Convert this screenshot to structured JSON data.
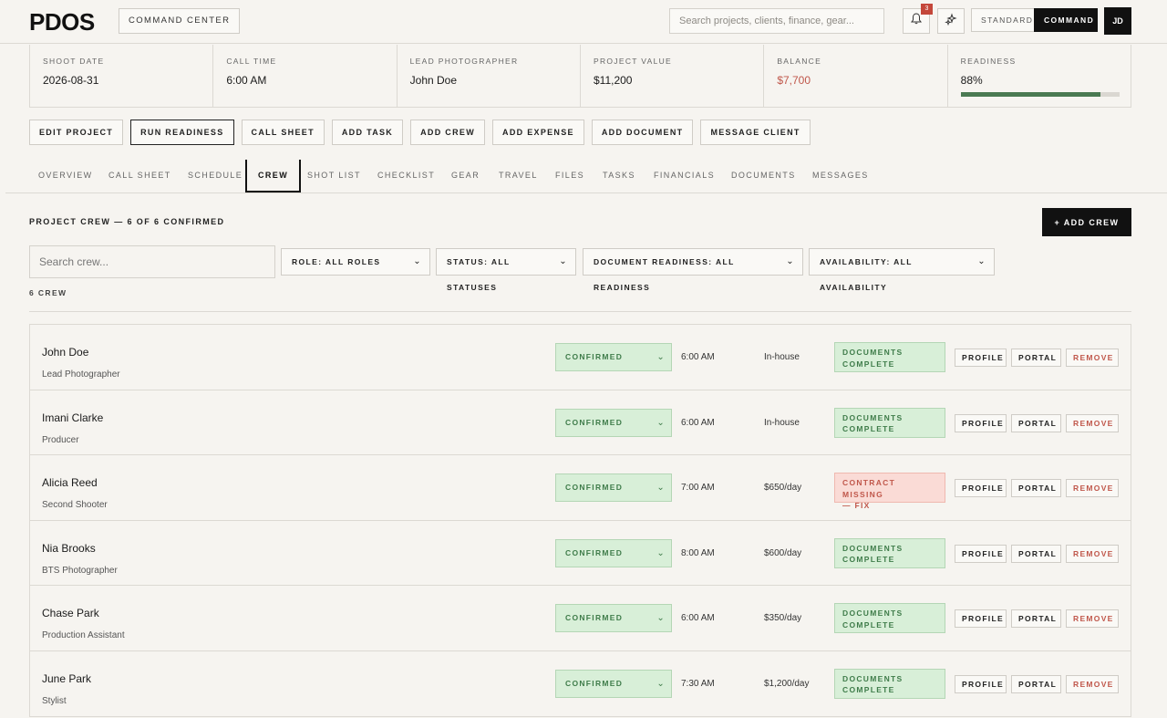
{
  "app": {
    "logo": "PDOS",
    "command_center": "COMMAND CENTER"
  },
  "search": {
    "placeholder": "Search projects, clients, finance, gear..."
  },
  "notifications": {
    "count": "3"
  },
  "modes": {
    "standard": "STANDARD",
    "command": "COMMAND"
  },
  "user": {
    "initials": "JD"
  },
  "stats": [
    {
      "label": "SHOOT DATE",
      "value": "2026-08-31"
    },
    {
      "label": "CALL TIME",
      "value": "6:00 AM"
    },
    {
      "label": "LEAD PHOTOGRAPHER",
      "value": "John Doe"
    },
    {
      "label": "PROJECT VALUE",
      "value": "$11,200"
    },
    {
      "label": "BALANCE",
      "value": "$7,700"
    },
    {
      "label": "READINESS",
      "value": "88%",
      "progress": 0.88
    }
  ],
  "actions": [
    "EDIT PROJECT",
    "RUN READINESS",
    "CALL SHEET",
    "ADD TASK",
    "ADD CREW",
    "ADD EXPENSE",
    "ADD DOCUMENT",
    "MESSAGE CLIENT"
  ],
  "tabs": [
    "OVERVIEW",
    "CALL SHEET",
    "SCHEDULE",
    "CREW",
    "SHOT LIST",
    "CHECKLIST",
    "GEAR",
    "TRAVEL",
    "FILES",
    "TASKS",
    "FINANCIALS",
    "DOCUMENTS",
    "MESSAGES"
  ],
  "crew_section": {
    "title": "PROJECT CREW — 6 OF 6 CONFIRMED",
    "add_button": "+ ADD CREW",
    "search_placeholder": "Search crew...",
    "count": "6 CREW"
  },
  "filters": {
    "role": "ROLE: ALL ROLES",
    "status": "STATUS: ALL STATUSES",
    "documents": "DOCUMENT READINESS: ALL READINESS",
    "availability": "AVAILABILITY: ALL AVAILABILITY"
  },
  "row_buttons": {
    "profile": "PROFILE",
    "portal": "PORTAL",
    "remove": "REMOVE"
  },
  "crew": [
    {
      "name": "John Doe",
      "role": "Lead Photographer",
      "status": "CONFIRMED",
      "call_time": "6:00 AM",
      "rate": "In-house",
      "docs_line1": "DOCUMENTS",
      "docs_line2": "COMPLETE"
    },
    {
      "name": "Imani Clarke",
      "role": "Producer",
      "status": "CONFIRMED",
      "call_time": "6:00 AM",
      "rate": "In-house",
      "docs_line1": "DOCUMENTS",
      "docs_line2": "COMPLETE"
    },
    {
      "name": "Alicia Reed",
      "role": "Second Shooter",
      "status": "CONFIRMED",
      "call_time": "7:00 AM",
      "rate": "$650/day",
      "docs_line1": "CONTRACT MISSING",
      "docs_line2": "— FIX"
    },
    {
      "name": "Nia Brooks",
      "role": "BTS Photographer",
      "status": "CONFIRMED",
      "call_time": "8:00 AM",
      "rate": "$600/day",
      "docs_line1": "DOCUMENTS",
      "docs_line2": "COMPLETE"
    },
    {
      "name": "Chase Park",
      "role": "Production Assistant",
      "status": "CONFIRMED",
      "call_time": "6:00 AM",
      "rate": "$350/day",
      "docs_line1": "DOCUMENTS",
      "docs_line2": "COMPLETE"
    },
    {
      "name": "June Park",
      "role": "Stylist",
      "status": "CONFIRMED",
      "call_time": "7:30 AM",
      "rate": "$1,200/day",
      "docs_line1": "DOCUMENTS",
      "docs_line2": "COMPLETE"
    }
  ],
  "colors": {
    "accent": "#111111",
    "success": "#3f7c4a",
    "danger": "#c0574b",
    "readiness_bar": "#4a7a52"
  }
}
